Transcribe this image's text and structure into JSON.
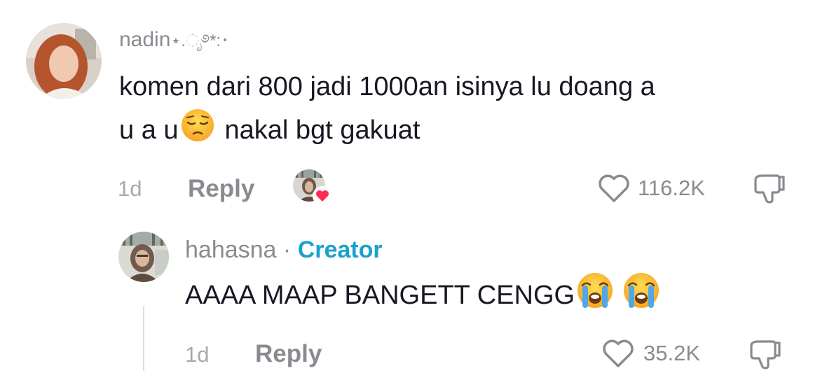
{
  "comment": {
    "username": "nadin",
    "username_decoration": "⋆.ೃ࿔*:･",
    "text_line1": "komen dari 800 jadi 1000an isinya lu doang a",
    "text_line2_start": "u a u",
    "text_line2_end": "nakal bgt gakuat",
    "emoji": "pensive-face",
    "time": "1d",
    "reply_label": "Reply",
    "creator_liked": true,
    "like_count": "116.2K"
  },
  "reply": {
    "username": "hahasna",
    "separator": "·",
    "badge": "Creator",
    "text": "AAAA MAAP BANGETT CENGG",
    "emojis": [
      "loudly-crying-face",
      "loudly-crying-face"
    ],
    "time": "1d",
    "reply_label": "Reply",
    "like_count": "35.2K"
  },
  "colors": {
    "badge": "#1aa2ce",
    "liked_heart": "#fe2c55",
    "muted": "#8a8b91",
    "text": "#161823"
  }
}
